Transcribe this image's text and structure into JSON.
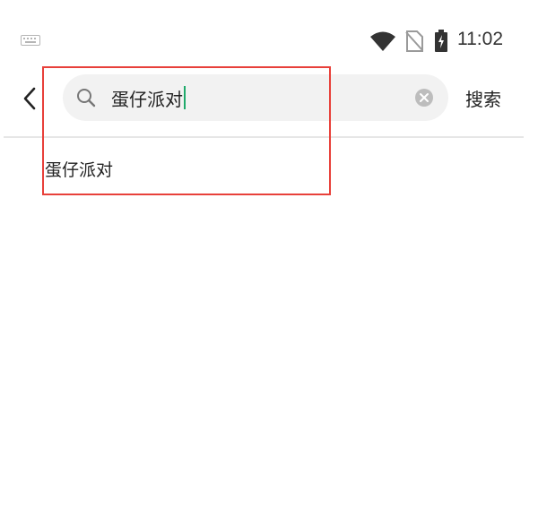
{
  "status_bar": {
    "time": "11:02",
    "icons": [
      "keyboard-icon",
      "wifi-icon",
      "no-sim-icon",
      "battery-charging-icon"
    ]
  },
  "header": {
    "back_icon": "chevron-left-icon",
    "search": {
      "value": "蛋仔派对",
      "icon": "search-icon",
      "clear_icon": "clear-icon"
    },
    "action_label": "搜索"
  },
  "suggestions": [
    {
      "label": "蛋仔派对"
    }
  ],
  "colors": {
    "caret": "#1faa6b",
    "annotation_box": "#e8403a",
    "search_bg": "#f2f2f2"
  }
}
